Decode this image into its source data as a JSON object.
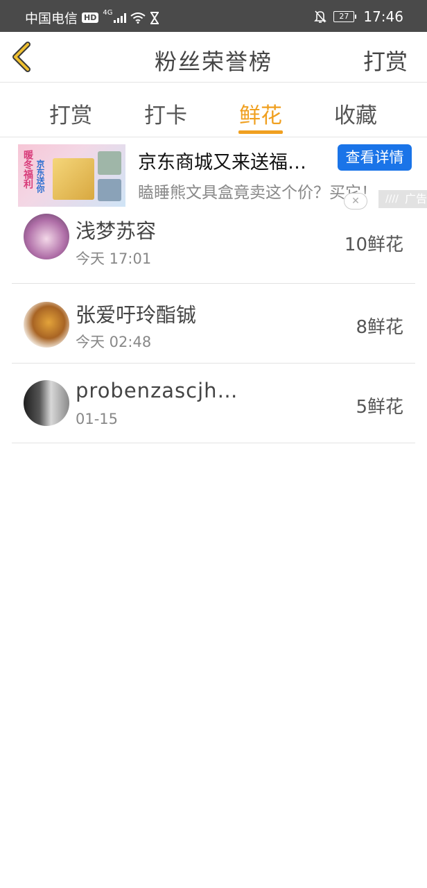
{
  "status_bar": {
    "carrier": "中国电信",
    "hd": "HD",
    "network": "4G",
    "battery": "27",
    "time": "17:46"
  },
  "header": {
    "title": "粉丝荣誉榜",
    "action": "打赏"
  },
  "tabs": [
    {
      "label": "打赏",
      "active": false
    },
    {
      "label": "打卡",
      "active": false
    },
    {
      "label": "鲜花",
      "active": true
    },
    {
      "label": "收藏",
      "active": false
    }
  ],
  "ad": {
    "title": "京东商城又来送福…",
    "button": "查看详情",
    "description": "瞌睡熊文具盒竟卖这个价？买它！",
    "label": "广告",
    "image_text_1": "暖冬福利",
    "image_text_2": "京东送你"
  },
  "list": [
    {
      "name": "浅梦苏容",
      "date": "今天  17:01",
      "amount": "10鲜花"
    },
    {
      "name": "张爱吁玲酯铖",
      "date": "今天  02:48",
      "amount": "8鲜花"
    },
    {
      "name": "probenzascjh…",
      "date": "01-15",
      "amount": "5鲜花"
    }
  ],
  "colors": {
    "accent": "#f0a020",
    "ad_button": "#1a74e8",
    "status_bar": "#4a4a4a"
  },
  "icons": [
    "back-chevron-icon",
    "wifi-icon",
    "hourglass-icon",
    "mute-bell-icon"
  ]
}
